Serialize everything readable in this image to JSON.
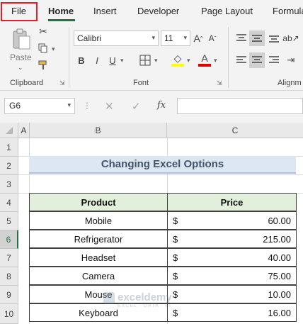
{
  "tabs": [
    {
      "label": "File"
    },
    {
      "label": "Home"
    },
    {
      "label": "Insert"
    },
    {
      "label": "Developer"
    },
    {
      "label": "Page Layout"
    },
    {
      "label": "Formula"
    }
  ],
  "ribbon": {
    "paste_label": "Paste",
    "font_name": "Calibri",
    "font_size": "11",
    "groups": {
      "clipboard": "Clipboard",
      "font": "Font",
      "alignment": "Alignm"
    },
    "bold": "B",
    "italic": "I",
    "underline": "U",
    "font_color_accent": "#e00000",
    "highlight_accent": "#ffff00"
  },
  "formula_bar": {
    "name_box": "G6",
    "fx": "fx",
    "content": ""
  },
  "columns": [
    "A",
    "B",
    "C"
  ],
  "rows": [
    "1",
    "2",
    "3",
    "4",
    "5",
    "6",
    "7",
    "8",
    "9",
    "10"
  ],
  "sheet": {
    "title": "Changing Excel Options",
    "headers": {
      "product": "Product",
      "price": "Price"
    },
    "currency": "$",
    "items": [
      {
        "product": "Mobile",
        "price": "60.00"
      },
      {
        "product": "Refrigerator",
        "price": "215.00"
      },
      {
        "product": "Headset",
        "price": "40.00"
      },
      {
        "product": "Camera",
        "price": "75.00"
      },
      {
        "product": "Mouse",
        "price": "10.00"
      },
      {
        "product": "Keyboard",
        "price": "16.00"
      }
    ]
  },
  "watermark": {
    "name": "exceldemy",
    "tagline": "EXCEL · DATA · BI"
  }
}
